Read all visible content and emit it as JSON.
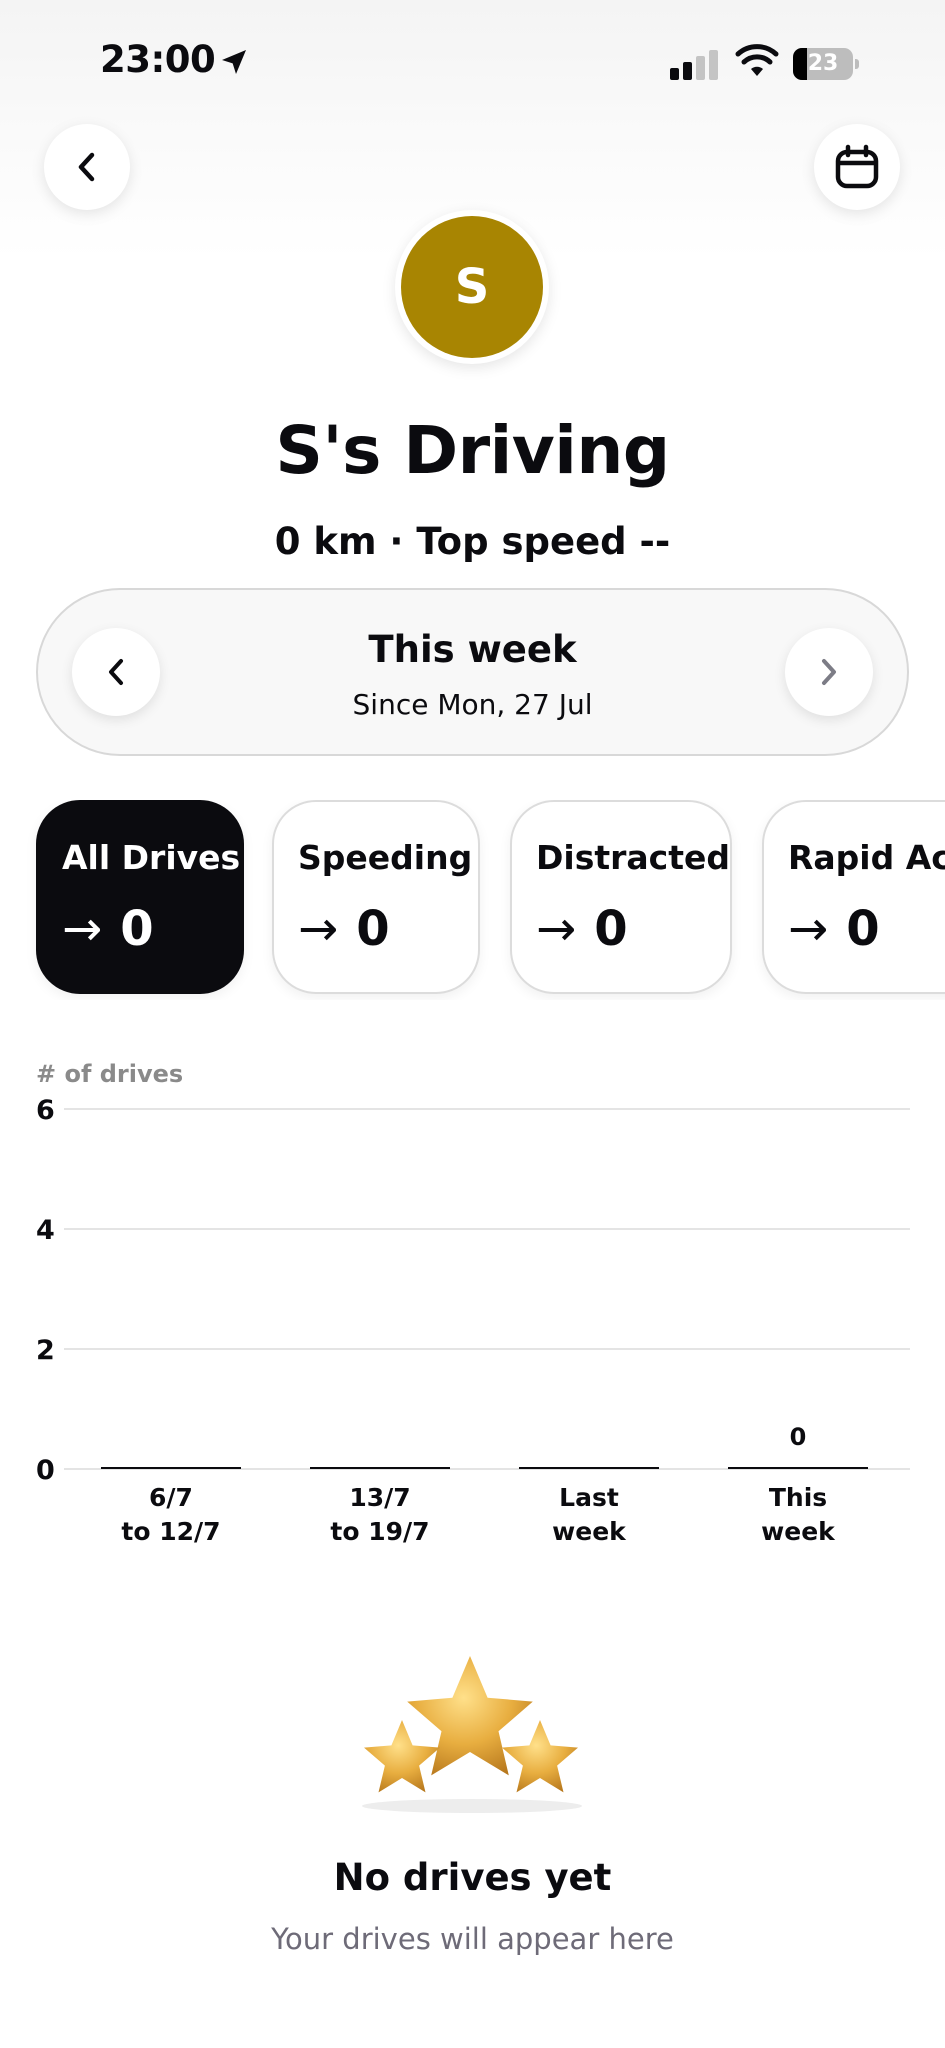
{
  "status_bar": {
    "time": "23:00",
    "battery_level": "23",
    "battery_fraction": 0.23,
    "signal_bars_active": 2,
    "signal_bars_total": 4
  },
  "header": {
    "back_icon": "chevron-left-icon",
    "calendar_icon": "calendar-icon"
  },
  "profile": {
    "avatar_initial": "S",
    "avatar_color": "#a88502",
    "title": "S's Driving",
    "subtitle": "0 km · Top speed --"
  },
  "period": {
    "title": "This week",
    "subtitle": "Since Mon, 27 Jul"
  },
  "filters": [
    {
      "label": "All Drives",
      "arrow": "→",
      "value": "0",
      "active": true
    },
    {
      "label": "Speeding",
      "arrow": "→",
      "value": "0",
      "active": false
    },
    {
      "label": "Distracted",
      "arrow": "→",
      "value": "0",
      "active": false
    },
    {
      "label": "Rapid Acc",
      "arrow": "→",
      "value": "0",
      "active": false
    }
  ],
  "chart_data": {
    "type": "bar",
    "ylabel": "# of drives",
    "ylim": [
      0,
      6
    ],
    "yticks": [
      "0",
      "2",
      "4",
      "6"
    ],
    "grid": true,
    "categories": [
      [
        "6/7",
        "to 12/7"
      ],
      [
        "13/7",
        "to 19/7"
      ],
      [
        "Last",
        "week"
      ],
      [
        "This",
        "week"
      ]
    ],
    "values": [
      0,
      0,
      0,
      0
    ],
    "data_labels": [
      "",
      "",
      "",
      "0"
    ]
  },
  "empty_state": {
    "icon": "stars-icon",
    "title": "No drives yet",
    "subtitle": "Your drives will appear here"
  },
  "colors": {
    "accent_dark": "#0b0b0f",
    "star_gold": "#e2a93a"
  }
}
